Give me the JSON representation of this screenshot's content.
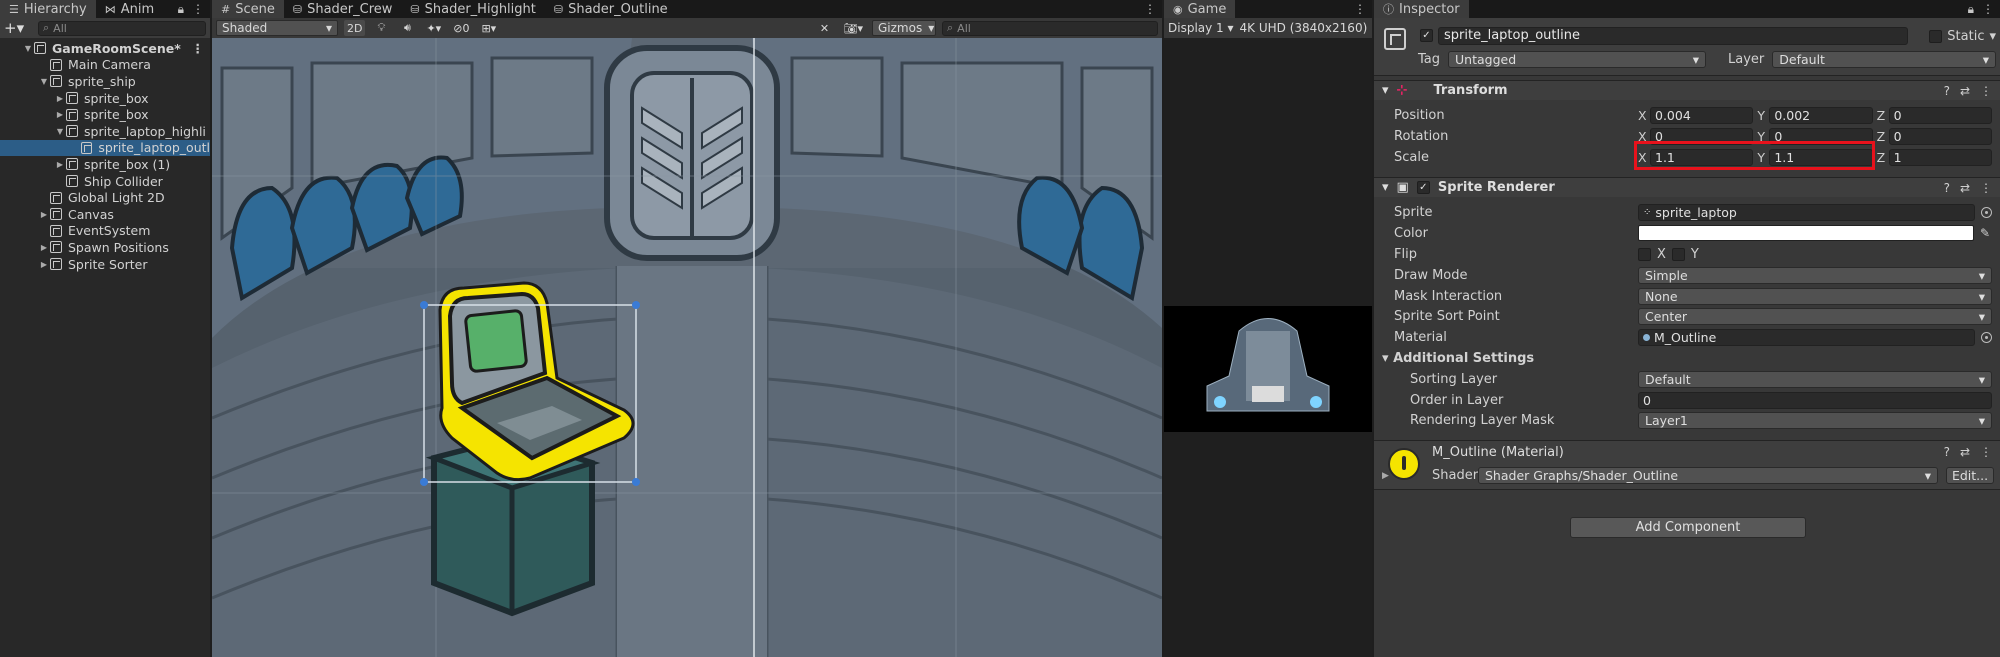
{
  "hierarchy": {
    "tab_label": "Hierarchy",
    "anim_tab_label": "Anim",
    "search_placeholder": "All",
    "items": [
      {
        "label": "GameRoomScene*",
        "depth": 0,
        "expanded": true,
        "type": "scene"
      },
      {
        "label": "Main Camera",
        "depth": 1,
        "expanded": null
      },
      {
        "label": "sprite_ship",
        "depth": 1,
        "expanded": true
      },
      {
        "label": "sprite_box",
        "depth": 2,
        "expanded": false
      },
      {
        "label": "sprite_box",
        "depth": 2,
        "expanded": false
      },
      {
        "label": "sprite_laptop_highli",
        "depth": 2,
        "expanded": true
      },
      {
        "label": "sprite_laptop_outl",
        "depth": 3,
        "expanded": null,
        "selected": true
      },
      {
        "label": "sprite_box (1)",
        "depth": 2,
        "expanded": false
      },
      {
        "label": "Ship Collider",
        "depth": 2,
        "expanded": null
      },
      {
        "label": "Global Light 2D",
        "depth": 1,
        "expanded": null
      },
      {
        "label": "Canvas",
        "depth": 1,
        "expanded": false
      },
      {
        "label": "EventSystem",
        "depth": 1,
        "expanded": null
      },
      {
        "label": "Spawn Positions",
        "depth": 1,
        "expanded": false
      },
      {
        "label": "Sprite Sorter",
        "depth": 1,
        "expanded": false
      }
    ]
  },
  "scene": {
    "tabs": [
      {
        "label": "Scene",
        "icon": "grid-icon",
        "active": true
      },
      {
        "label": "Shader_Crew",
        "icon": "shader-graph-icon"
      },
      {
        "label": "Shader_Highlight",
        "icon": "shader-graph-icon"
      },
      {
        "label": "Shader_Outline",
        "icon": "shader-graph-icon"
      }
    ],
    "shading_mode": "Shaded",
    "mode_2d": "2D",
    "hidden_count": "0",
    "gizmos_label": "Gizmos",
    "search_placeholder": "All"
  },
  "game": {
    "tab_label": "Game",
    "display": "Display 1",
    "resolution": "4K UHD (3840x2160)"
  },
  "inspector": {
    "tab_label": "Inspector",
    "object_name": "sprite_laptop_outline",
    "static_label": "Static",
    "tag_label": "Tag",
    "tag_value": "Untagged",
    "layer_label": "Layer",
    "layer_value": "Default",
    "transform": {
      "title": "Transform",
      "position_label": "Position",
      "position": {
        "x": "0.004",
        "y": "0.002",
        "z": "0"
      },
      "rotation_label": "Rotation",
      "rotation": {
        "x": "0",
        "y": "0",
        "z": "0"
      },
      "scale_label": "Scale",
      "scale": {
        "x": "1.1",
        "y": "1.1",
        "z": "1"
      }
    },
    "sprite_renderer": {
      "title": "Sprite Renderer",
      "sprite_label": "Sprite",
      "sprite_value": "sprite_laptop",
      "color_label": "Color",
      "color_value": "#ffffff",
      "flip_label": "Flip",
      "flip_x": "X",
      "flip_y": "Y",
      "draw_mode_label": "Draw Mode",
      "draw_mode_value": "Simple",
      "mask_label": "Mask Interaction",
      "mask_value": "None",
      "sort_point_label": "Sprite Sort Point",
      "sort_point_value": "Center",
      "material_label": "Material",
      "material_value": "M_Outline",
      "additional_label": "Additional Settings",
      "sorting_layer_label": "Sorting Layer",
      "sorting_layer_value": "Default",
      "order_label": "Order in Layer",
      "order_value": "0",
      "render_mask_label": "Rendering Layer Mask",
      "render_mask_value": "Layer1"
    },
    "material": {
      "title": "M_Outline (Material)",
      "shader_label": "Shader",
      "shader_value": "Shader Graphs/Shader_Outline",
      "edit_label": "Edit..."
    },
    "add_component_label": "Add Component"
  },
  "colors": {
    "selection": "#2c5d87",
    "highlight_box": "#e8121c",
    "outline_yellow": "#f5e400"
  }
}
